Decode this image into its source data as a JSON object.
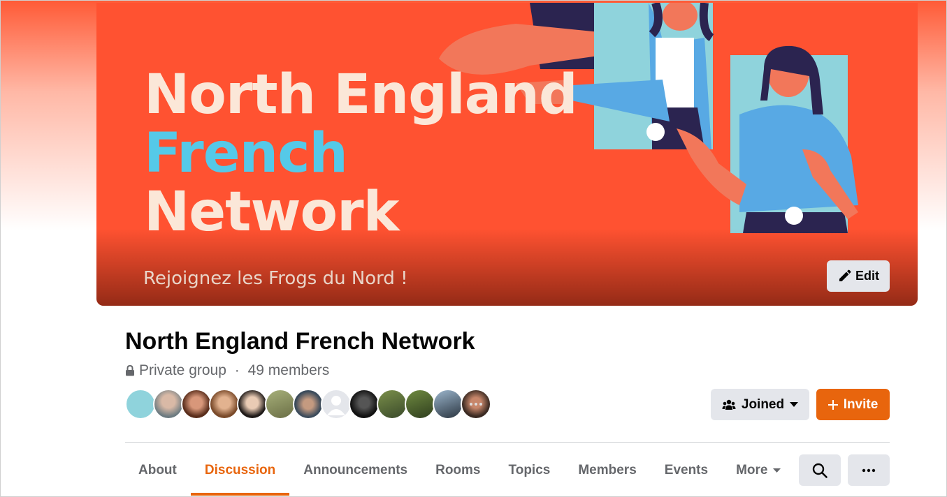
{
  "cover": {
    "title_line1": "North England",
    "title_line2": "French",
    "title_line3": "Network",
    "subtitle": "Rejoignez les Frogs du Nord !",
    "edit_label": "Edit",
    "edit_icon": "pencil-icon"
  },
  "group": {
    "name": "North England French Network",
    "privacy": "Private group",
    "separator": " · ",
    "members": "49 members",
    "privacy_icon": "lock-icon"
  },
  "actions": {
    "joined_label": "Joined",
    "invite_label": "Invite"
  },
  "tabs": [
    {
      "label": "About"
    },
    {
      "label": "Discussion",
      "active": true
    },
    {
      "label": "Announcements"
    },
    {
      "label": "Rooms"
    },
    {
      "label": "Topics"
    },
    {
      "label": "Members"
    },
    {
      "label": "Events"
    },
    {
      "label": "More"
    }
  ],
  "colors": {
    "accent": "#e8650d",
    "cover_bg": "#ff5231",
    "cover_blue": "#55c9e8",
    "cover_cream": "#fbe7d8"
  }
}
